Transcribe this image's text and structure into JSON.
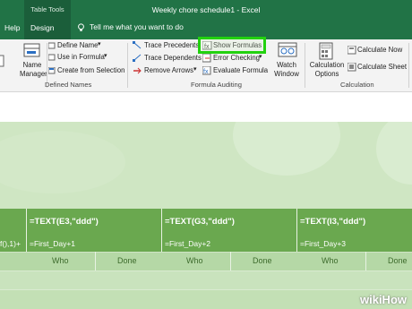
{
  "window": {
    "title": "Weekly chore schedule1  -  Excel"
  },
  "context_tab": {
    "caption": "Table Tools"
  },
  "tabs": [
    {
      "label": "Help"
    },
    {
      "label": "Design"
    }
  ],
  "tell_me": {
    "text": "Tell me what you want to do"
  },
  "ribbon": {
    "defined_names": {
      "name_manager": "Name\nManager",
      "define_name": "Define Name",
      "use_in_formula": "Use in Formula",
      "create_from_selection": "Create from Selection",
      "group_label": "Defined Names"
    },
    "formula_auditing": {
      "trace_precedents": "Trace Precedents",
      "trace_dependents": "Trace Dependents",
      "remove_arrows": "Remove Arrows",
      "show_formulas": "Show Formulas",
      "error_checking": "Error Checking",
      "evaluate_formula": "Evaluate Formula",
      "watch_window": "Watch\nWindow",
      "group_label": "Formula Auditing"
    },
    "calculation": {
      "calculation_options": "Calculation\nOptions",
      "calculate_now": "Calculate Now",
      "calculate_sheet": "Calculate Sheet",
      "group_label": "Calculation"
    }
  },
  "sheet": {
    "header_cells": [
      "=TEXT(E3,\"ddd\")",
      "=TEXT(G3,\"ddd\")",
      "=TEXT(I3,\"ddd\")"
    ],
    "date_cells": [
      "f(),1)+",
      "=First_Day+1",
      "=First_Day+2",
      "=First_Day+3"
    ],
    "columns": [
      "Who",
      "Done",
      "Who",
      "Done",
      "Who",
      "Done"
    ]
  },
  "watermark": "wikiHow",
  "colors": {
    "excel_green": "#217346",
    "highlight": "#22d10f",
    "table_header": "#6aa84f"
  }
}
